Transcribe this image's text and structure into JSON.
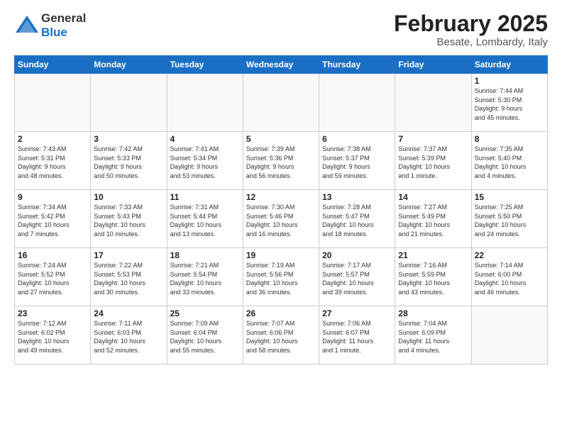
{
  "header": {
    "logo_general": "General",
    "logo_blue": "Blue",
    "title": "February 2025",
    "subtitle": "Besate, Lombardy, Italy"
  },
  "days_of_week": [
    "Sunday",
    "Monday",
    "Tuesday",
    "Wednesday",
    "Thursday",
    "Friday",
    "Saturday"
  ],
  "weeks": [
    [
      {
        "day": "",
        "info": ""
      },
      {
        "day": "",
        "info": ""
      },
      {
        "day": "",
        "info": ""
      },
      {
        "day": "",
        "info": ""
      },
      {
        "day": "",
        "info": ""
      },
      {
        "day": "",
        "info": ""
      },
      {
        "day": "1",
        "info": "Sunrise: 7:44 AM\nSunset: 5:30 PM\nDaylight: 9 hours\nand 45 minutes."
      }
    ],
    [
      {
        "day": "2",
        "info": "Sunrise: 7:43 AM\nSunset: 5:31 PM\nDaylight: 9 hours\nand 48 minutes."
      },
      {
        "day": "3",
        "info": "Sunrise: 7:42 AM\nSunset: 5:33 PM\nDaylight: 9 hours\nand 50 minutes."
      },
      {
        "day": "4",
        "info": "Sunrise: 7:41 AM\nSunset: 5:34 PM\nDaylight: 9 hours\nand 53 minutes."
      },
      {
        "day": "5",
        "info": "Sunrise: 7:39 AM\nSunset: 5:36 PM\nDaylight: 9 hours\nand 56 minutes."
      },
      {
        "day": "6",
        "info": "Sunrise: 7:38 AM\nSunset: 5:37 PM\nDaylight: 9 hours\nand 59 minutes."
      },
      {
        "day": "7",
        "info": "Sunrise: 7:37 AM\nSunset: 5:39 PM\nDaylight: 10 hours\nand 1 minute."
      },
      {
        "day": "8",
        "info": "Sunrise: 7:35 AM\nSunset: 5:40 PM\nDaylight: 10 hours\nand 4 minutes."
      }
    ],
    [
      {
        "day": "9",
        "info": "Sunrise: 7:34 AM\nSunset: 5:42 PM\nDaylight: 10 hours\nand 7 minutes."
      },
      {
        "day": "10",
        "info": "Sunrise: 7:33 AM\nSunset: 5:43 PM\nDaylight: 10 hours\nand 10 minutes."
      },
      {
        "day": "11",
        "info": "Sunrise: 7:31 AM\nSunset: 5:44 PM\nDaylight: 10 hours\nand 13 minutes."
      },
      {
        "day": "12",
        "info": "Sunrise: 7:30 AM\nSunset: 5:46 PM\nDaylight: 10 hours\nand 16 minutes."
      },
      {
        "day": "13",
        "info": "Sunrise: 7:28 AM\nSunset: 5:47 PM\nDaylight: 10 hours\nand 18 minutes."
      },
      {
        "day": "14",
        "info": "Sunrise: 7:27 AM\nSunset: 5:49 PM\nDaylight: 10 hours\nand 21 minutes."
      },
      {
        "day": "15",
        "info": "Sunrise: 7:25 AM\nSunset: 5:50 PM\nDaylight: 10 hours\nand 24 minutes."
      }
    ],
    [
      {
        "day": "16",
        "info": "Sunrise: 7:24 AM\nSunset: 5:52 PM\nDaylight: 10 hours\nand 27 minutes."
      },
      {
        "day": "17",
        "info": "Sunrise: 7:22 AM\nSunset: 5:53 PM\nDaylight: 10 hours\nand 30 minutes."
      },
      {
        "day": "18",
        "info": "Sunrise: 7:21 AM\nSunset: 5:54 PM\nDaylight: 10 hours\nand 33 minutes."
      },
      {
        "day": "19",
        "info": "Sunrise: 7:19 AM\nSunset: 5:56 PM\nDaylight: 10 hours\nand 36 minutes."
      },
      {
        "day": "20",
        "info": "Sunrise: 7:17 AM\nSunset: 5:57 PM\nDaylight: 10 hours\nand 39 minutes."
      },
      {
        "day": "21",
        "info": "Sunrise: 7:16 AM\nSunset: 5:59 PM\nDaylight: 10 hours\nand 43 minutes."
      },
      {
        "day": "22",
        "info": "Sunrise: 7:14 AM\nSunset: 6:00 PM\nDaylight: 10 hours\nand 46 minutes."
      }
    ],
    [
      {
        "day": "23",
        "info": "Sunrise: 7:12 AM\nSunset: 6:02 PM\nDaylight: 10 hours\nand 49 minutes."
      },
      {
        "day": "24",
        "info": "Sunrise: 7:11 AM\nSunset: 6:03 PM\nDaylight: 10 hours\nand 52 minutes."
      },
      {
        "day": "25",
        "info": "Sunrise: 7:09 AM\nSunset: 6:04 PM\nDaylight: 10 hours\nand 55 minutes."
      },
      {
        "day": "26",
        "info": "Sunrise: 7:07 AM\nSunset: 6:06 PM\nDaylight: 10 hours\nand 58 minutes."
      },
      {
        "day": "27",
        "info": "Sunrise: 7:06 AM\nSunset: 6:07 PM\nDaylight: 11 hours\nand 1 minute."
      },
      {
        "day": "28",
        "info": "Sunrise: 7:04 AM\nSunset: 6:09 PM\nDaylight: 11 hours\nand 4 minutes."
      },
      {
        "day": "",
        "info": ""
      }
    ]
  ]
}
